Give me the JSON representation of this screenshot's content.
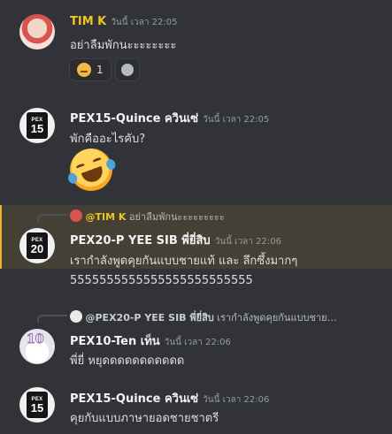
{
  "messages": [
    {
      "author": "TIM K",
      "time": "วันนี้ เวลา 22:05",
      "text": "อย่าลืมพักนะะะะะะะะ",
      "reactions": [
        {
          "emoji": "thinking-face",
          "count": "1"
        }
      ]
    },
    {
      "author": "PEX15-Quince ควินเซ่",
      "time": "วันนี้ เวลา 22:05",
      "text": "พักคืออะไรคับ?",
      "avatar_badge": {
        "top": "PEX",
        "num": "15"
      }
    },
    {
      "reply_author": "@TIM K",
      "reply_text": "อย่าลืมพักนะะะะะะะะะ",
      "author": "PEX20-P YEE SIB พี่ยี่สิบ",
      "time": "วันนี้ เวลา 22:06",
      "text": "เรากำลังพูดคุยกันแบบชายแท้ และ ลึกซึ้งมากๆ",
      "text2": "5555555555555555555555555",
      "avatar_badge": {
        "top": "PEX",
        "num": "20"
      }
    },
    {
      "reply_author": "@PEX20-P YEE SIB พี่ยี่สิบ",
      "reply_text": "เรากำลังพูดคุยกันแบบชาย…",
      "author": "PEX10-Ten เท็น",
      "time": "วันนี้ เวลา 22:06",
      "text": "พี่ยี่ หยุดดดดดดดดดดด",
      "avatar_num": "10"
    },
    {
      "author": "PEX15-Quince ควินเซ่",
      "time": "วันนี้ เวลา 22:06",
      "text": "คุยกับแบบภาษายอดชายชาตรี",
      "avatar_badge": {
        "top": "PEX",
        "num": "15"
      }
    }
  ],
  "colors": {
    "background": "#313338",
    "mention_highlight": "#444035",
    "mention_bar": "#f0b232",
    "tim_name": "#f0c61e"
  }
}
